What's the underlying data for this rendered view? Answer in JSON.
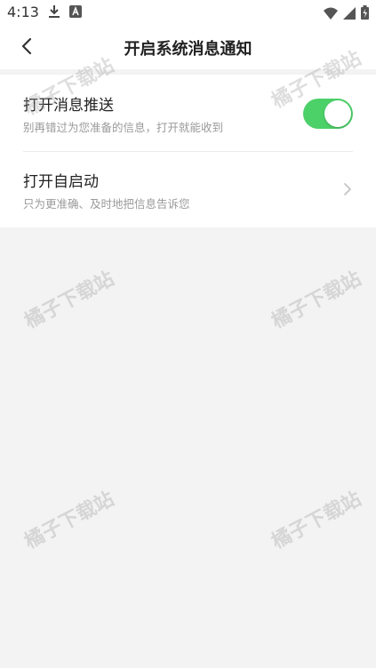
{
  "status_bar": {
    "time": "4:13",
    "left_icons": [
      "download-icon",
      "a-badge-icon"
    ],
    "right_icons": [
      "wifi-icon",
      "signal-icon",
      "battery-icon"
    ]
  },
  "nav": {
    "title": "开启系统消息通知",
    "back_icon": "chevron-left-icon"
  },
  "settings": [
    {
      "title": "打开消息推送",
      "subtitle": "别再错过为您准备的信息，打开就能收到",
      "control": "toggle",
      "enabled": true
    },
    {
      "title": "打开自启动",
      "subtitle": "只为更准确、及时地把信息告诉您",
      "control": "chevron",
      "icon": "chevron-right-icon"
    }
  ],
  "watermark": {
    "text": "橘子下载站"
  },
  "colors": {
    "toggle_on": "#4cd068",
    "background": "#f3f3f3",
    "card": "#ffffff",
    "subtitle": "#9a9a9a"
  }
}
